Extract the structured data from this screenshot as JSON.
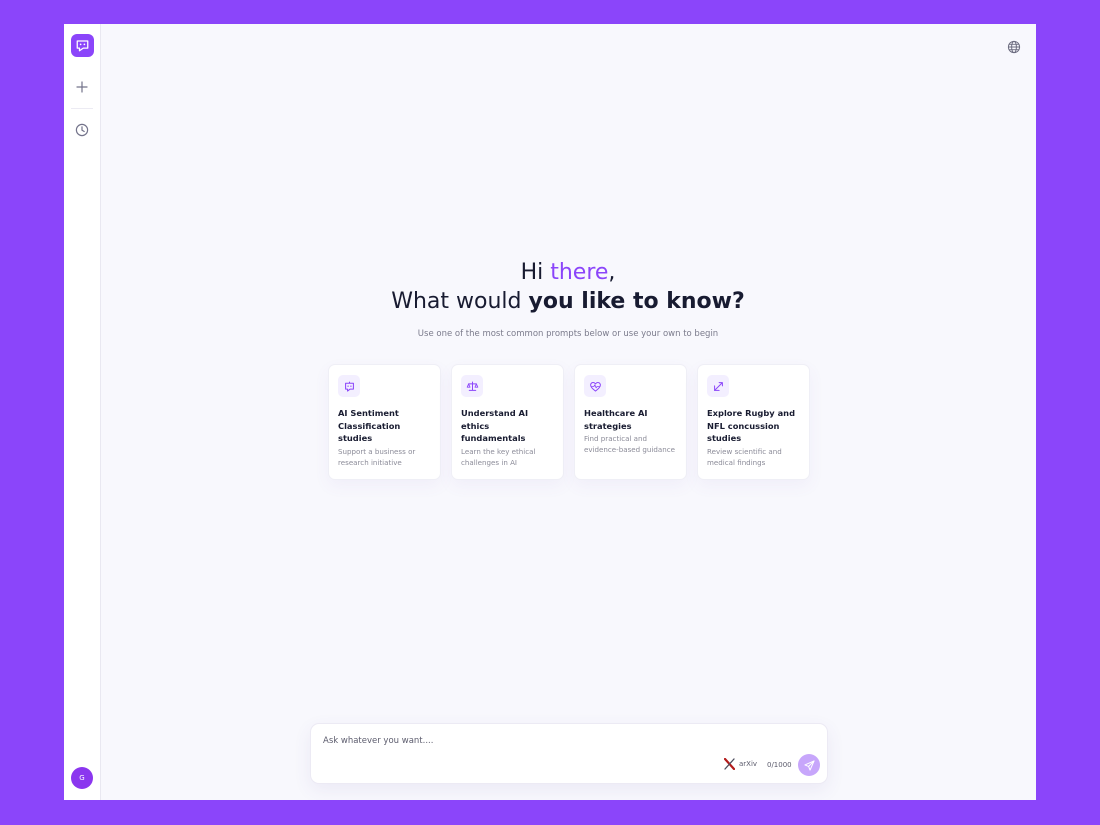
{
  "sidebar": {
    "logo_icon": "chat-bot-icon",
    "new_chat_icon": "plus-icon",
    "history_icon": "clock-icon",
    "avatar_initial": "G"
  },
  "topbar": {
    "language_icon": "globe-icon"
  },
  "hero": {
    "greeting_prefix": "Hi ",
    "greeting_accent": "there",
    "greeting_suffix": ",",
    "question_prefix": "What would ",
    "question_bold": "you like to know?",
    "subtitle": "Use one of the most common prompts below or use your own to begin"
  },
  "prompts": [
    {
      "title": "AI Sentiment Classification studies",
      "description": "Support a business or research initiative",
      "icon": "chat-bot-icon"
    },
    {
      "title": "Understand AI ethics fundamentals",
      "description": "Learn the key ethical challenges in AI",
      "icon": "scales-icon"
    },
    {
      "title": "Healthcare AI strategies",
      "description": "Find practical and evidence-based guidance",
      "icon": "heart-pulse-icon"
    },
    {
      "title": "Explore Rugby and NFL concussion studies",
      "description": "Review scientific and medical findings",
      "icon": "arrows-icon"
    }
  ],
  "composer": {
    "placeholder": "Ask whatever you want....",
    "source_label": "arXiv",
    "counter": "0/1000",
    "send_icon": "paper-plane-icon"
  },
  "colors": {
    "accent": "#8B45FA",
    "send_disabled": "#C7A6FB",
    "background": "#F8F8FD"
  }
}
